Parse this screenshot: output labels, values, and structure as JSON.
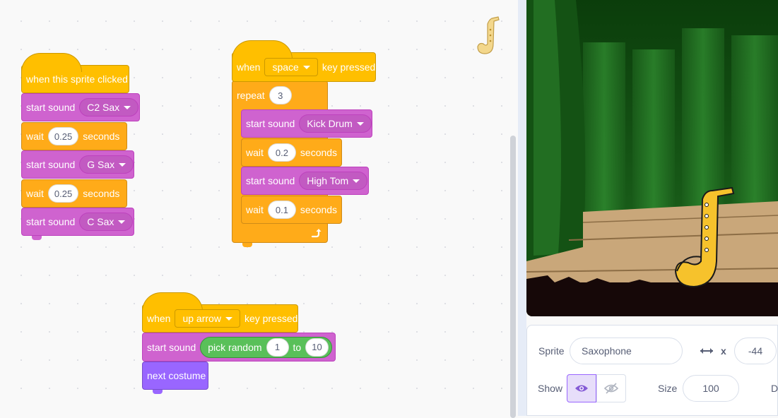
{
  "workspace": {
    "stack1": {
      "hat": "when this sprite clicked",
      "b1_label": "start sound",
      "b1_sound": "C2 Sax",
      "wait_label": "wait",
      "wait1_value": "0.25",
      "seconds": "seconds",
      "b3_label": "start sound",
      "b3_sound": "G Sax",
      "wait2_value": "0.25",
      "b5_label": "start sound",
      "b5_sound": "C Sax"
    },
    "stack2": {
      "when": "when",
      "key": "space",
      "key_pressed": "key pressed",
      "repeat_label": "repeat",
      "repeat_value": "3",
      "s1_label": "start sound",
      "s1_sound": "Kick Drum",
      "wait_label": "wait",
      "w1_value": "0.2",
      "seconds": "seconds",
      "s2_label": "start sound",
      "s2_sound": "High Tom",
      "w2_value": "0.1"
    },
    "stack3": {
      "when": "when",
      "key": "up arrow",
      "key_pressed": "key pressed",
      "s_label": "start sound",
      "pick_random": "pick random",
      "from": "1",
      "to_label": "to",
      "to": "10",
      "next_costume": "next costume"
    }
  },
  "sprite_info": {
    "sprite_label": "Sprite",
    "sprite_name": "Saxophone",
    "x_label": "x",
    "x_value": "-44",
    "show_label": "Show",
    "size_label": "Size",
    "size_value": "100",
    "direction_label_partial": "Di"
  },
  "colors": {
    "events": "#ffbf00",
    "sound": "#cf63cf",
    "control": "#ffab19",
    "looks": "#9966ff",
    "operators": "#59c059"
  },
  "icons": [
    "saxophone-sprite-icon",
    "dropdown-caret-icon",
    "loop-arrow-icon",
    "eye-icon",
    "eye-slash-icon",
    "x-arrows-icon"
  ]
}
